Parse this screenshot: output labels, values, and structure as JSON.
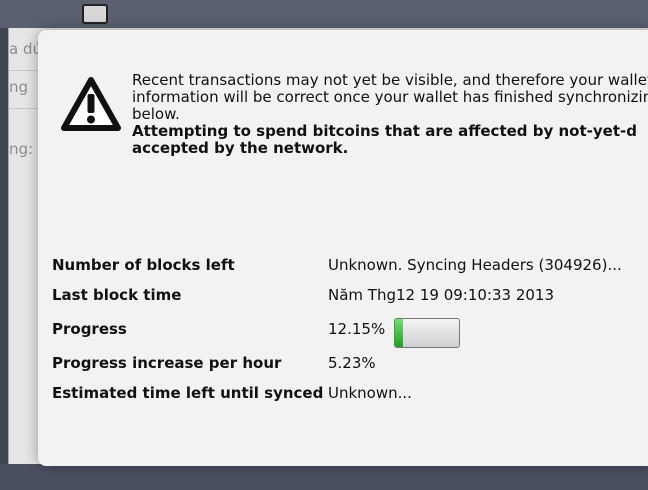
{
  "background": {
    "line1": "a dứ",
    "line2": "ng",
    "line3": "ng:"
  },
  "warning": {
    "icon": "warning-triangle-icon",
    "line1": "Recent transactions may not yet be visible, and therefore your wallet",
    "line2": "information will be correct once your wallet has finished synchronizin",
    "line3": "below.",
    "bold_line1": "Attempting to spend bitcoins that are affected by not-yet-d",
    "bold_line2": "accepted by the network."
  },
  "sync_info": {
    "blocks_left_label": "Number of blocks left",
    "blocks_left_value": "Unknown. Syncing Headers (304926)...",
    "last_block_label": "Last block time",
    "last_block_value": "Năm Thg12 19 09:10:33 2013",
    "progress_label": "Progress",
    "progress_value": "12.15%",
    "progress_fraction": 0.1215,
    "rate_label": "Progress increase per hour",
    "rate_value": "5.23%",
    "eta_label": "Estimated time left until synced",
    "eta_value": "Unknown..."
  },
  "colors": {
    "progress_fill": "#1aa51a",
    "overlay_bg": "#f2f2f0"
  }
}
